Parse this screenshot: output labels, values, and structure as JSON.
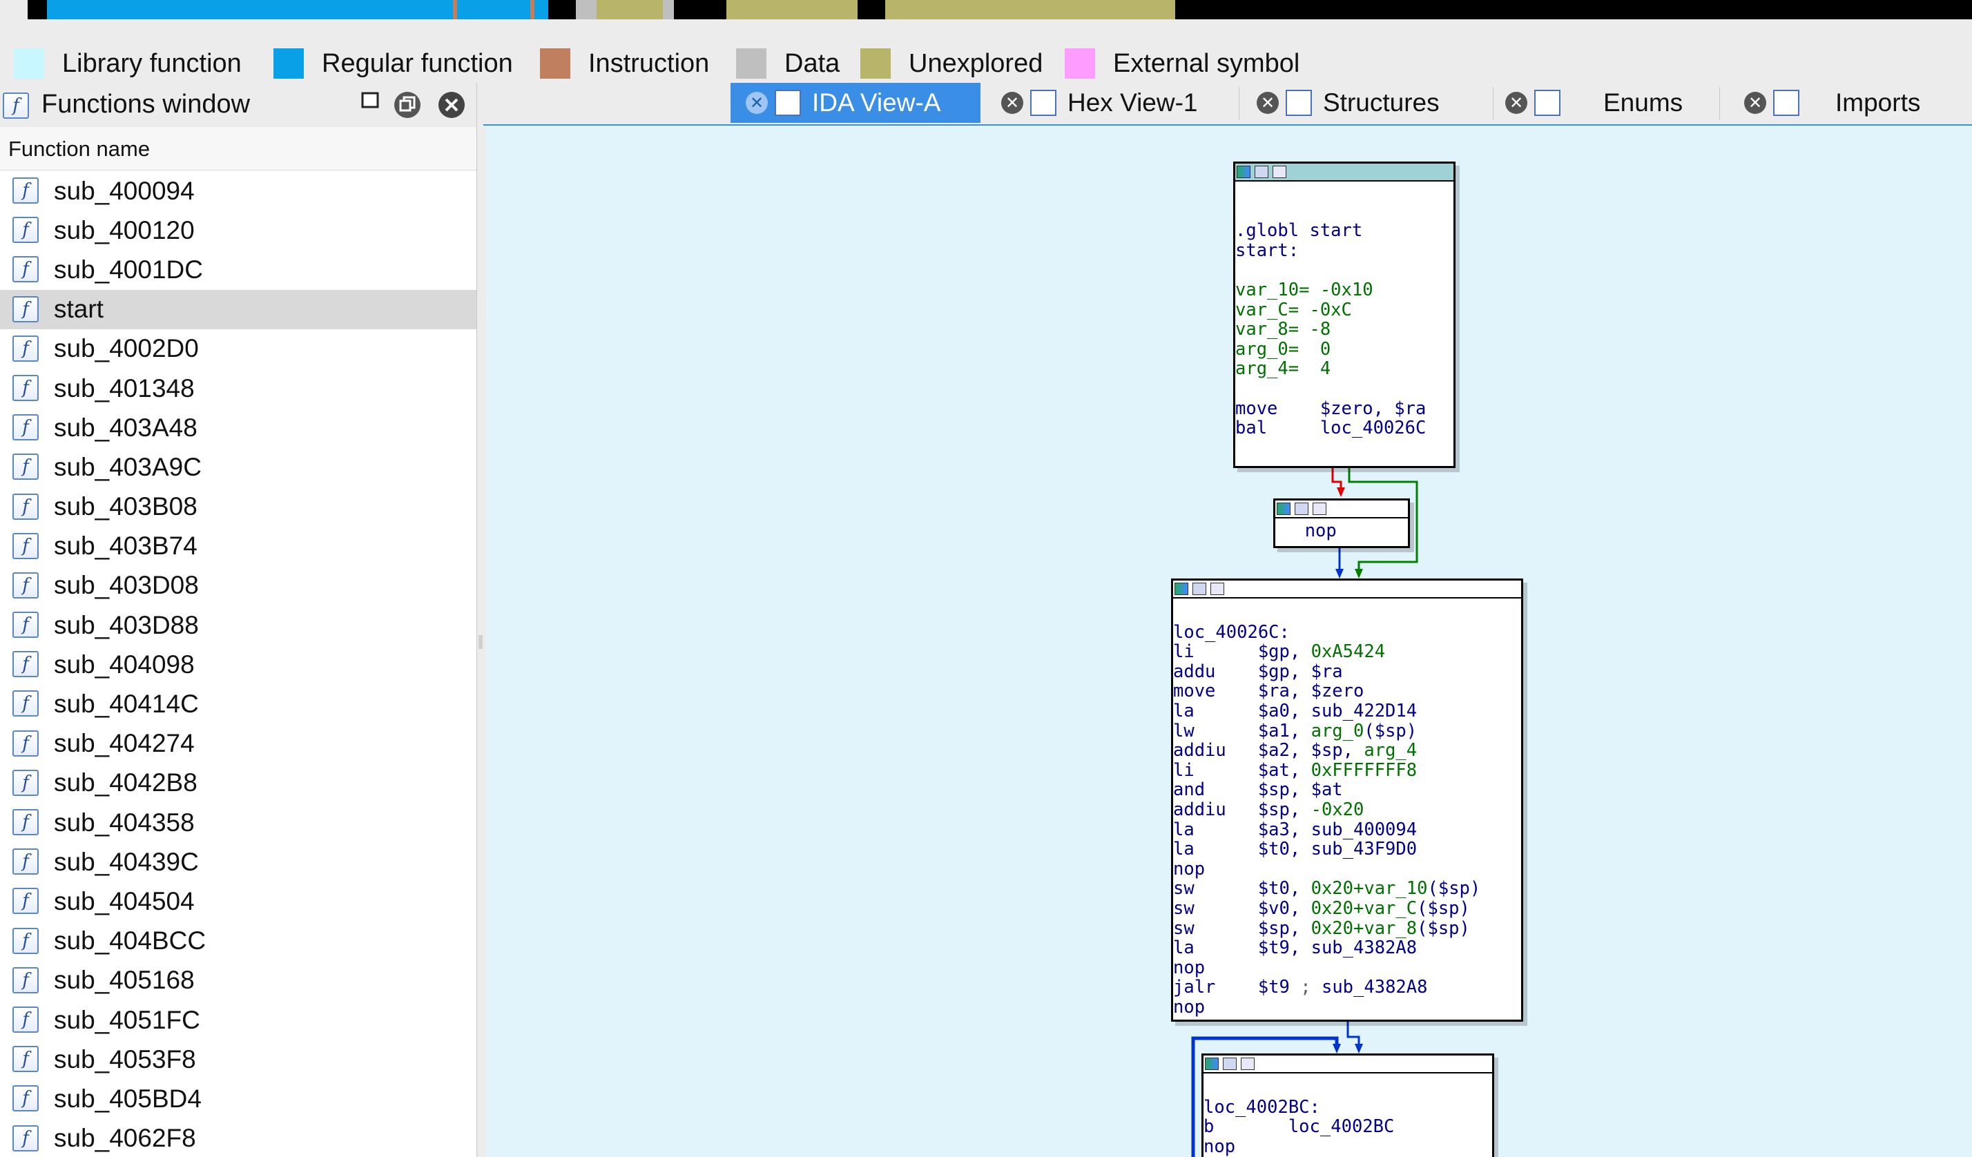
{
  "legend": {
    "items": [
      {
        "label": "Library function",
        "color": "#c8f7ff"
      },
      {
        "label": "Regular function",
        "color": "#0aa0e8"
      },
      {
        "label": "Instruction",
        "color": "#c08060"
      },
      {
        "label": "Data",
        "color": "#bfbfbf"
      },
      {
        "label": "Unexplored",
        "color": "#b8b46a"
      },
      {
        "label": "External symbol",
        "color": "#ff9cff"
      }
    ]
  },
  "functions_window": {
    "title": "Functions window",
    "column_header": "Function name",
    "items": [
      "sub_400094",
      "sub_400120",
      "sub_4001DC",
      "start",
      "sub_4002D0",
      "sub_401348",
      "sub_403A48",
      "sub_403A9C",
      "sub_403B08",
      "sub_403B74",
      "sub_403D08",
      "sub_403D88",
      "sub_404098",
      "sub_40414C",
      "sub_404274",
      "sub_4042B8",
      "sub_404358",
      "sub_40439C",
      "sub_404504",
      "sub_404BCC",
      "sub_405168",
      "sub_4051FC",
      "sub_4053F8",
      "sub_405BD4",
      "sub_4062F8"
    ],
    "selected": "start"
  },
  "tabs": [
    {
      "label": "IDA View-A",
      "active": true,
      "icon": "ida-view-icon"
    },
    {
      "label": "Hex View-1",
      "active": false,
      "icon": "hex-view-icon"
    },
    {
      "label": "Structures",
      "active": false,
      "icon": "structures-icon"
    },
    {
      "label": "Enums",
      "active": false,
      "icon": "enums-icon"
    },
    {
      "label": "Imports",
      "active": false,
      "icon": "imports-icon"
    }
  ],
  "graph": {
    "blocks": [
      {
        "id": "start",
        "lines": [
          [],
          [],
          [
            {
              "t": ".globl start",
              "c": "name"
            }
          ],
          [
            {
              "t": "start:",
              "c": "name"
            }
          ],
          [],
          [
            {
              "t": "var_10= ",
              "c": "num"
            },
            {
              "t": "-0x10",
              "c": "num"
            }
          ],
          [
            {
              "t": "var_C= ",
              "c": "num"
            },
            {
              "t": "-0xC",
              "c": "num"
            }
          ],
          [
            {
              "t": "var_8= ",
              "c": "num"
            },
            {
              "t": "-8",
              "c": "num"
            }
          ],
          [
            {
              "t": "arg_0=  ",
              "c": "num"
            },
            {
              "t": "0",
              "c": "num"
            }
          ],
          [
            {
              "t": "arg_4=  ",
              "c": "num"
            },
            {
              "t": "4",
              "c": "num"
            }
          ],
          [],
          [
            {
              "t": "move    ",
              "c": "op"
            },
            {
              "t": "$zero, $ra",
              "c": "arg"
            }
          ],
          [
            {
              "t": "bal     ",
              "c": "op"
            },
            {
              "t": "loc_40026C",
              "c": "arg"
            }
          ]
        ]
      },
      {
        "id": "nop",
        "lines": [
          [
            {
              "t": "  nop",
              "c": "op"
            }
          ]
        ]
      },
      {
        "id": "loc_40026C",
        "lines": [
          [],
          [
            {
              "t": "loc_40026C:",
              "c": "name"
            }
          ],
          [
            {
              "t": "li      ",
              "c": "op"
            },
            {
              "t": "$gp, ",
              "c": "arg"
            },
            {
              "t": "0xA5424",
              "c": "num"
            }
          ],
          [
            {
              "t": "addu    ",
              "c": "op"
            },
            {
              "t": "$gp, $ra",
              "c": "arg"
            }
          ],
          [
            {
              "t": "move    ",
              "c": "op"
            },
            {
              "t": "$ra, $zero",
              "c": "arg"
            }
          ],
          [
            {
              "t": "la      ",
              "c": "op"
            },
            {
              "t": "$a0, sub_422D14",
              "c": "arg"
            }
          ],
          [
            {
              "t": "lw      ",
              "c": "op"
            },
            {
              "t": "$a1, ",
              "c": "arg"
            },
            {
              "t": "arg_0",
              "c": "num"
            },
            {
              "t": "($sp)",
              "c": "arg"
            }
          ],
          [
            {
              "t": "addiu   ",
              "c": "op"
            },
            {
              "t": "$a2, $sp, ",
              "c": "arg"
            },
            {
              "t": "arg_4",
              "c": "num"
            }
          ],
          [
            {
              "t": "li      ",
              "c": "op"
            },
            {
              "t": "$at, ",
              "c": "arg"
            },
            {
              "t": "0xFFFFFFF8",
              "c": "num"
            }
          ],
          [
            {
              "t": "and     ",
              "c": "op"
            },
            {
              "t": "$sp, $at",
              "c": "arg"
            }
          ],
          [
            {
              "t": "addiu   ",
              "c": "op"
            },
            {
              "t": "$sp, ",
              "c": "arg"
            },
            {
              "t": "-0x20",
              "c": "num"
            }
          ],
          [
            {
              "t": "la      ",
              "c": "op"
            },
            {
              "t": "$a3, sub_400094",
              "c": "arg"
            }
          ],
          [
            {
              "t": "la      ",
              "c": "op"
            },
            {
              "t": "$t0, sub_43F9D0",
              "c": "arg"
            }
          ],
          [
            {
              "t": "nop",
              "c": "op"
            }
          ],
          [
            {
              "t": "sw      ",
              "c": "op"
            },
            {
              "t": "$t0, ",
              "c": "arg"
            },
            {
              "t": "0x20+var_10",
              "c": "num"
            },
            {
              "t": "($sp)",
              "c": "arg"
            }
          ],
          [
            {
              "t": "sw      ",
              "c": "op"
            },
            {
              "t": "$v0, ",
              "c": "arg"
            },
            {
              "t": "0x20+var_C",
              "c": "num"
            },
            {
              "t": "($sp)",
              "c": "arg"
            }
          ],
          [
            {
              "t": "sw      ",
              "c": "op"
            },
            {
              "t": "$sp, ",
              "c": "arg"
            },
            {
              "t": "0x20+var_8",
              "c": "num"
            },
            {
              "t": "($sp)",
              "c": "arg"
            }
          ],
          [
            {
              "t": "la      ",
              "c": "op"
            },
            {
              "t": "$t9, sub_4382A8",
              "c": "arg"
            }
          ],
          [
            {
              "t": "nop",
              "c": "op"
            }
          ],
          [
            {
              "t": "jalr    ",
              "c": "op"
            },
            {
              "t": "$t9 ",
              "c": "arg"
            },
            {
              "t": "; ",
              "c": "cmt"
            },
            {
              "t": "sub_4382A8",
              "c": "arg"
            }
          ],
          [
            {
              "t": "nop",
              "c": "op"
            }
          ]
        ]
      },
      {
        "id": "loc_4002BC",
        "lines": [
          [],
          [
            {
              "t": "loc_4002BC:",
              "c": "name"
            }
          ],
          [
            {
              "t": "b       ",
              "c": "op"
            },
            {
              "t": "loc_4002BC",
              "c": "arg"
            }
          ],
          [
            {
              "t": "nop",
              "c": "op"
            }
          ]
        ]
      }
    ]
  }
}
